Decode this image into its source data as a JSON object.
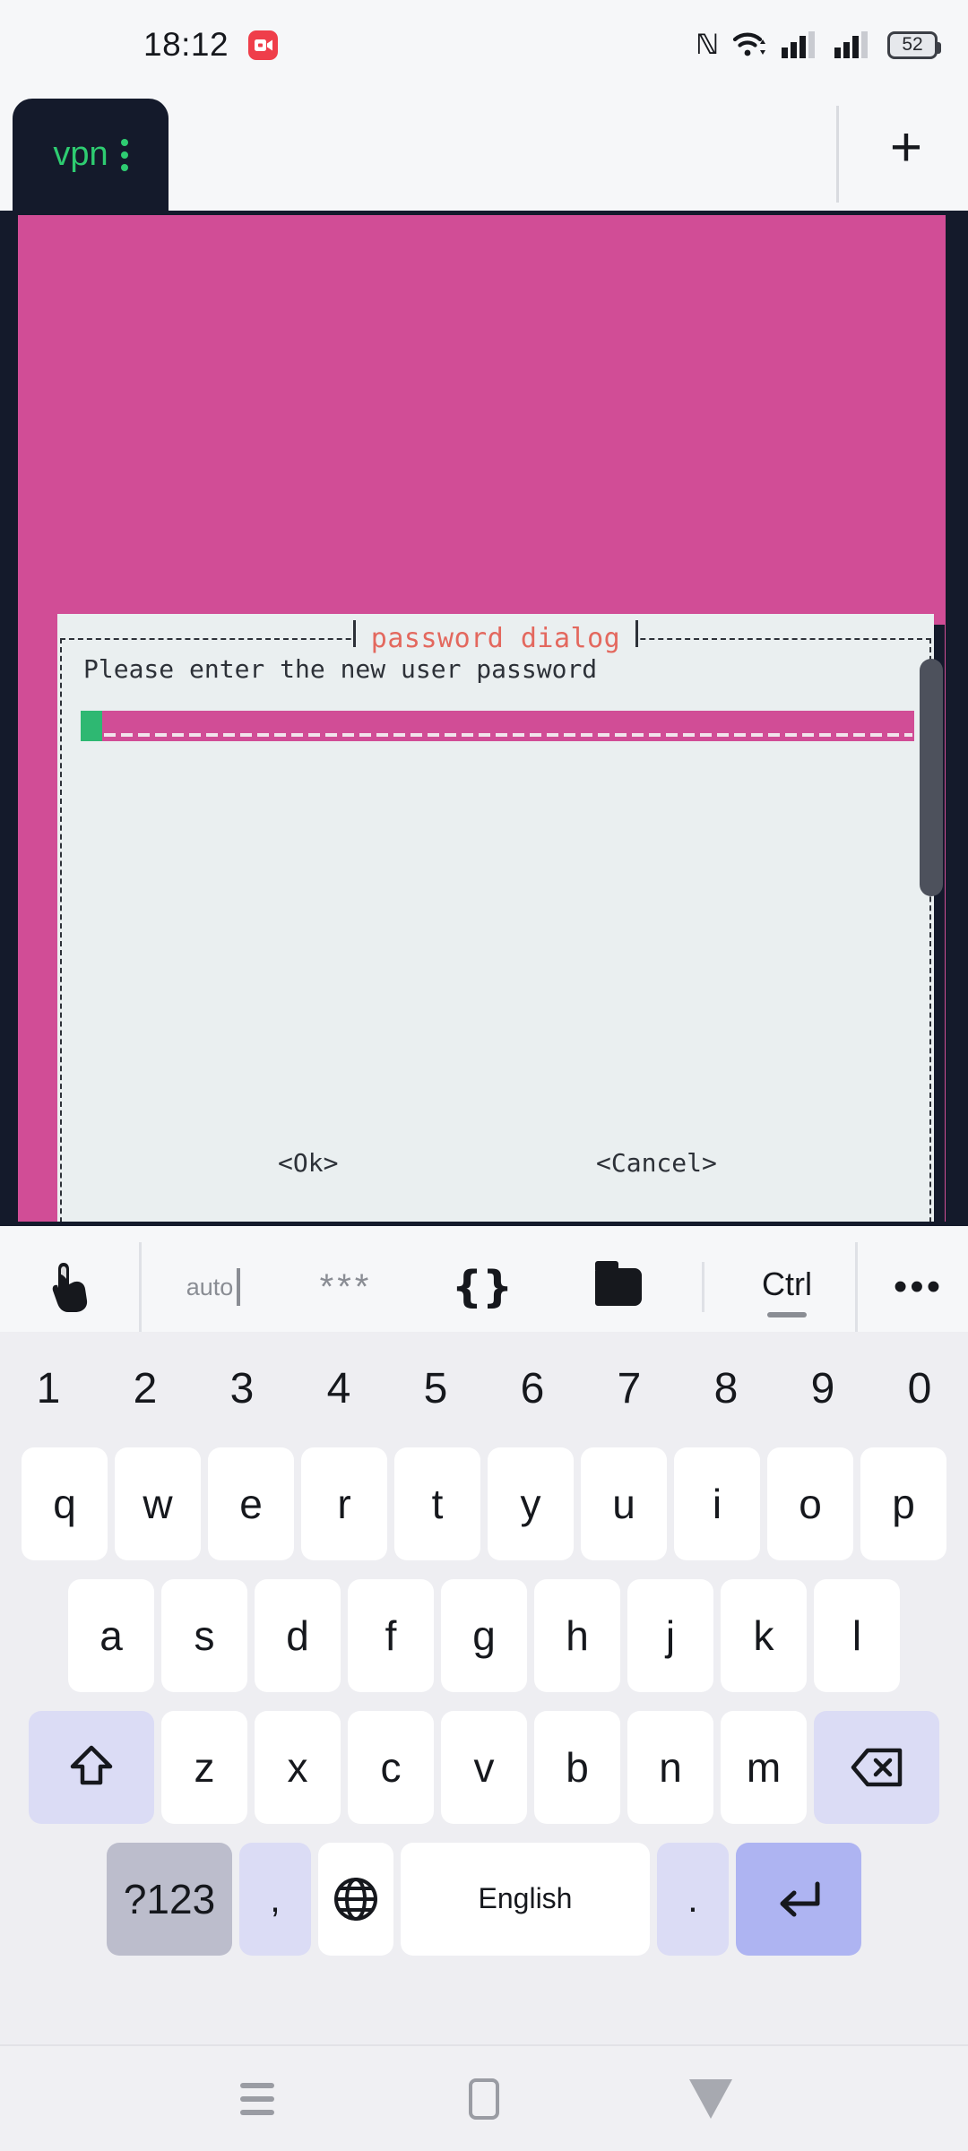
{
  "status_bar": {
    "time": "18:12",
    "recording_icon": "screen-record-icon",
    "nfc_glyph": "ℕ",
    "battery_level": "52",
    "icons": [
      "nfc-icon",
      "wifi-icon",
      "signal-1-icon",
      "signal-2-icon",
      "battery-icon"
    ]
  },
  "tab_bar": {
    "active_tab_label": "vpn",
    "kebab_menu": "kebab-menu-icon",
    "new_tab_label": "+"
  },
  "terminal": {
    "background_color": "#d14d96",
    "frame_color": "#141a2b",
    "scrollbar_color": "#4d515c"
  },
  "dialog": {
    "title": "password dialog",
    "title_color": "#e3685e",
    "prompt": "Please enter the new user password",
    "input_value": "",
    "input_background": "#d14d96",
    "cursor_color": "#2eb872",
    "buttons": [
      {
        "label": "<Ok>"
      },
      {
        "label": "<Cancel>"
      }
    ]
  },
  "extra_keys_bar": {
    "items": [
      {
        "name": "touch-pointer-icon",
        "label": ""
      },
      {
        "name": "auto-text",
        "label": "auto"
      },
      {
        "name": "asterisks-key",
        "label": "***"
      },
      {
        "name": "braces-key",
        "label": "{}"
      },
      {
        "name": "folder-icon",
        "label": ""
      },
      {
        "name": "ctrl-key",
        "label": "Ctrl"
      },
      {
        "name": "overflow-menu",
        "label": "•••"
      }
    ]
  },
  "keyboard": {
    "number_row": [
      "1",
      "2",
      "3",
      "4",
      "5",
      "6",
      "7",
      "8",
      "9",
      "0"
    ],
    "row1": [
      "q",
      "w",
      "e",
      "r",
      "t",
      "y",
      "u",
      "i",
      "o",
      "p"
    ],
    "row2": [
      "a",
      "s",
      "d",
      "f",
      "g",
      "h",
      "j",
      "k",
      "l"
    ],
    "row3": [
      "z",
      "x",
      "c",
      "v",
      "b",
      "n",
      "m"
    ],
    "shift_key": "shift-icon",
    "backspace_key": "backspace-icon",
    "symbols_key": "?123",
    "comma_key": ",",
    "globe_key": "globe-icon",
    "space_key": "English",
    "period_key": ".",
    "enter_key": "enter-icon",
    "key_color": "#ffffff",
    "modifier_color": "#dbdcf5",
    "enter_color": "#aeb4f2"
  },
  "nav_bar": {
    "recents": "recents-icon",
    "home": "home-icon",
    "back": "back-icon"
  }
}
